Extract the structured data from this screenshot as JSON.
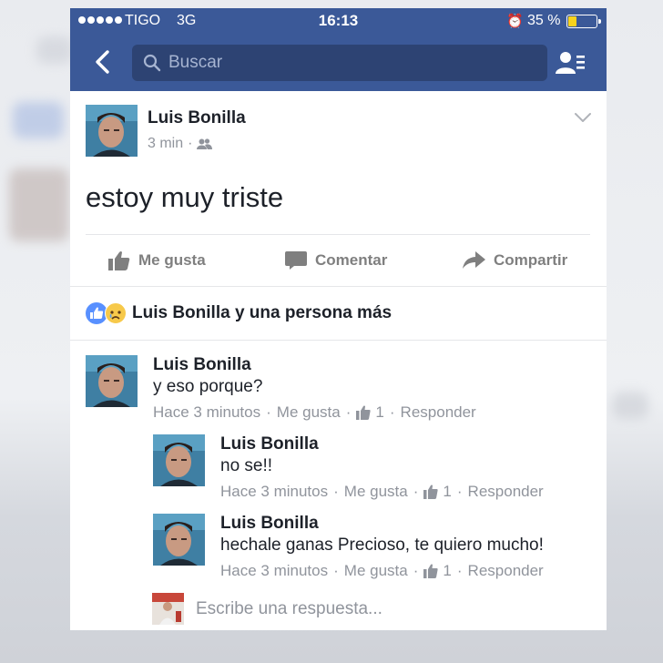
{
  "status_bar": {
    "carrier": "TIGO",
    "network": "3G",
    "time": "16:13",
    "battery_text": "35 %",
    "battery_level": 0.35,
    "battery_color": "#f8d31c"
  },
  "nav": {
    "search_placeholder": "Buscar",
    "icons": [
      "back-arrow-icon",
      "search-icon",
      "friends-list-icon"
    ]
  },
  "post": {
    "author": "Luis Bonilla",
    "time": "3 min",
    "dot": "·",
    "text": "estoy muy triste",
    "privacy_icon": "friends-icon"
  },
  "actions": {
    "like": "Me gusta",
    "comment": "Comentar",
    "share": "Compartir"
  },
  "reactions": {
    "summary": "Luis Bonilla y una persona más",
    "icons": [
      "like-reaction-icon",
      "sad-reaction-icon"
    ]
  },
  "comments": [
    {
      "author": "Luis Bonilla",
      "text": "y eso porque?",
      "time": "Hace 3 minutos",
      "like": "Me gusta",
      "likes": "1",
      "reply": "Responder",
      "sep": "·",
      "replies": [
        {
          "author": "Luis Bonilla",
          "text": "no se!!",
          "time": "Hace 3 minutos",
          "like": "Me gusta",
          "likes": "1",
          "reply": "Responder",
          "sep": "·"
        },
        {
          "author": "Luis Bonilla",
          "text": "hechale ganas Precioso, te quiero mucho!",
          "time": "Hace 3 minutos",
          "like": "Me gusta",
          "likes": "1",
          "reply": "Responder",
          "sep": "·"
        }
      ]
    }
  ],
  "reply_box": {
    "placeholder": "Escribe una respuesta..."
  },
  "colors": {
    "facebook_blue": "#3b5998",
    "like_blue": "#5890ff",
    "text_primary": "#1d2129",
    "text_secondary": "#90949c"
  }
}
